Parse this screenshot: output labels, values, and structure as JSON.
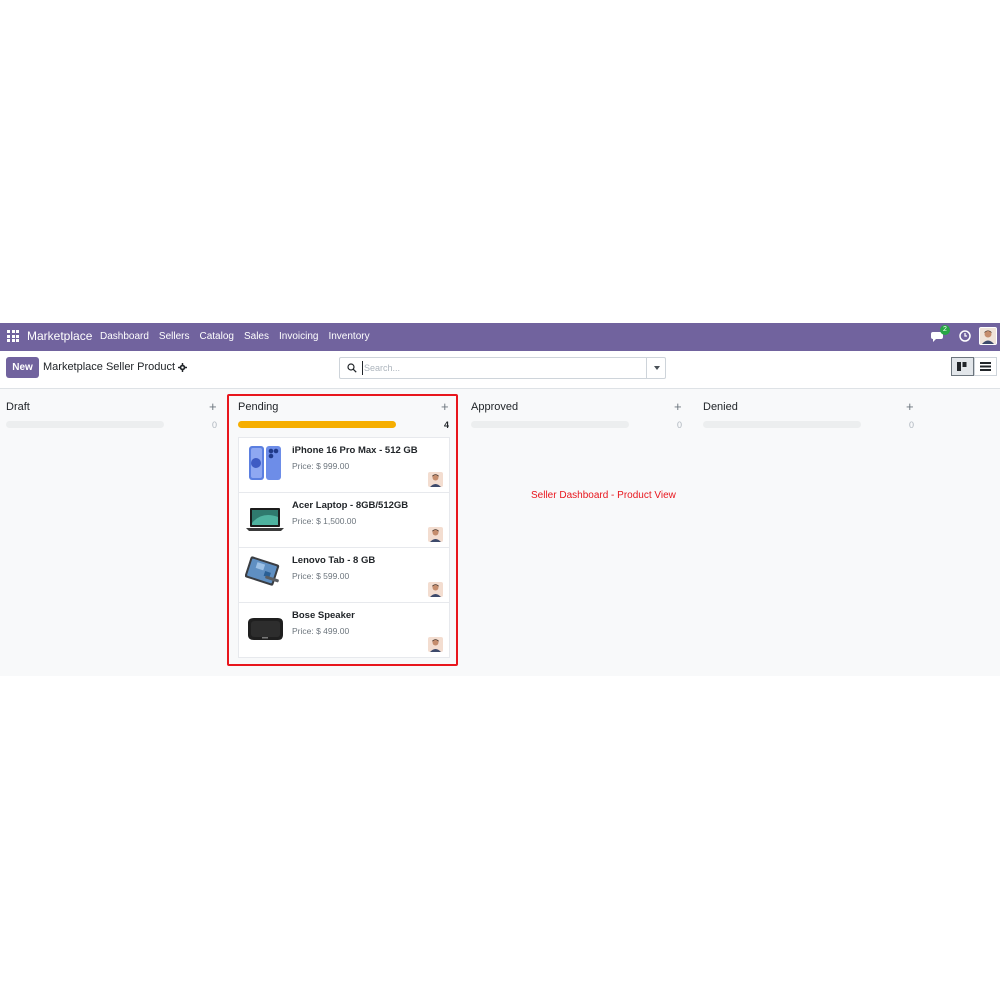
{
  "navbar": {
    "brand": "Marketplace",
    "menu": [
      "Dashboard",
      "Sellers",
      "Catalog",
      "Sales",
      "Invoicing",
      "Inventory"
    ],
    "chat_count": "2",
    "bg_color": "#71639e"
  },
  "control": {
    "new_label": "New",
    "breadcrumb": "Marketplace Seller Product",
    "search_placeholder": "Search..."
  },
  "columns": [
    {
      "title": "Draft",
      "count": "0",
      "progress": 0
    },
    {
      "title": "Pending",
      "count": "4",
      "progress": 1.0
    },
    {
      "title": "Approved",
      "count": "0",
      "progress": 0
    },
    {
      "title": "Denied",
      "count": "0",
      "progress": 0
    }
  ],
  "cards": [
    {
      "name": "iPhone 16 Pro Max - 512 GB",
      "price": "Price: $ 999.00",
      "image": "phone-icon"
    },
    {
      "name": "Acer Laptop - 8GB/512GB",
      "price": "Price: $ 1,500.00",
      "image": "laptop-icon"
    },
    {
      "name": "Lenovo Tab - 8 GB",
      "price": "Price: $ 599.00",
      "image": "tablet-icon"
    },
    {
      "name": "Bose Speaker",
      "price": "Price: $ 499.00",
      "image": "speaker-icon"
    }
  ],
  "annotation": {
    "caption": "Seller Dashboard - Product View",
    "color": "#e8161d"
  }
}
